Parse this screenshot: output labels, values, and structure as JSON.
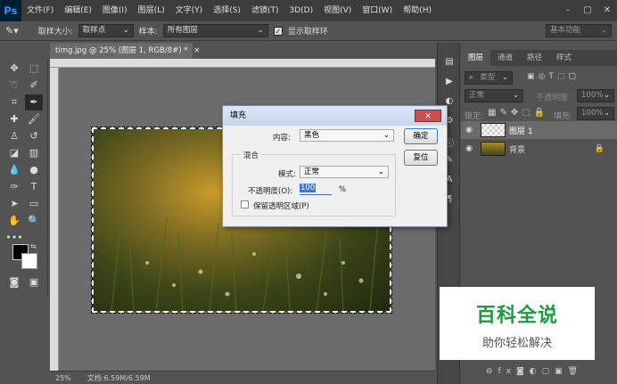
{
  "app": {
    "logo": "Ps"
  },
  "menu": [
    "文件(F)",
    "编辑(E)",
    "图像(I)",
    "图层(L)",
    "文字(Y)",
    "选择(S)",
    "滤镜(T)",
    "3D(D)",
    "视图(V)",
    "窗口(W)",
    "帮助(H)"
  ],
  "window_controls": {
    "minimize": "–",
    "restore": "▢",
    "close": "✕"
  },
  "options": {
    "sample_size_label": "取样大小:",
    "sample_size_value": "取样点",
    "sample_label": "样本:",
    "sample_value": "所有图层",
    "show_ring_label": "显示取样环",
    "workspace": "基本功能"
  },
  "document": {
    "tab_title": "timg.jpg @ 25% (图层 1, RGB/8#) *",
    "tab_close": "×",
    "zoom": "25%",
    "doc_size": "文档:6.59M/6.59M"
  },
  "layers_panel": {
    "tabs": [
      "图层",
      "通道",
      "路径",
      "样式"
    ],
    "kind_filter": "类型",
    "blend_mode": "正常",
    "opacity_label": "不透明度:",
    "opacity_value": "100%",
    "lock_label": "锁定:",
    "fill_label": "填充:",
    "fill_value": "100%",
    "layers": [
      {
        "name": "图层 1"
      },
      {
        "name": "背景"
      }
    ]
  },
  "dialog": {
    "title": "填充",
    "close": "✕",
    "content_label": "内容:",
    "content_value": "黑色",
    "blend_group": "混合",
    "mode_label": "模式:",
    "mode_value": "正常",
    "opacity_label": "不透明度(O):",
    "opacity_value": "100",
    "opacity_unit": "%",
    "preserve_label": "保留透明区域(P)",
    "ok": "确定",
    "reset": "复位"
  },
  "watermark": {
    "title": "百科全说",
    "subtitle": "助你轻松解决"
  }
}
